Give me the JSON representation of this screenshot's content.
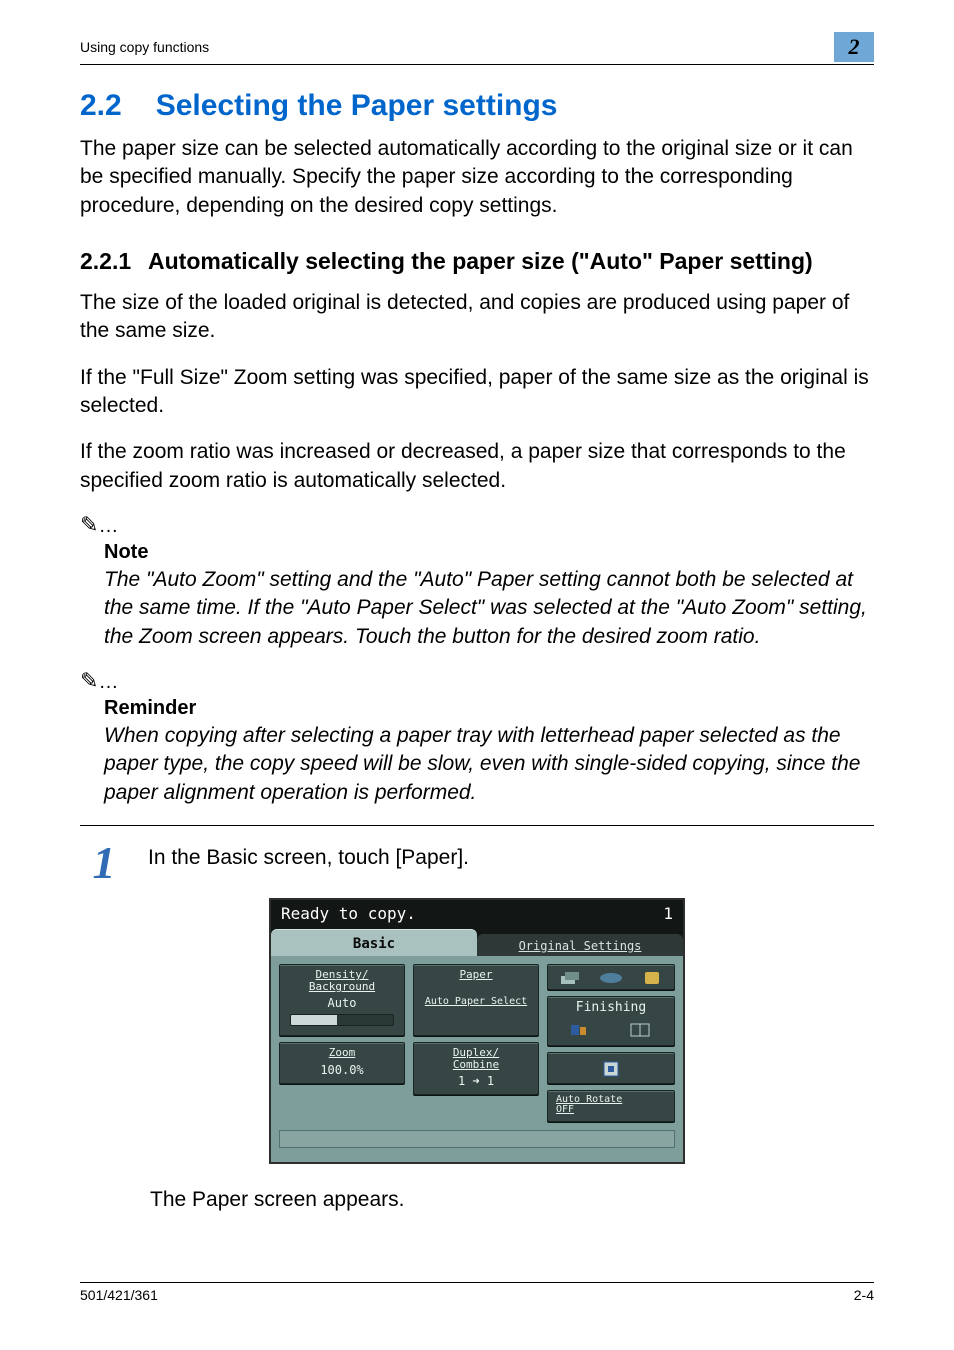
{
  "header": {
    "running_title": "Using copy functions",
    "chapter_number": "2"
  },
  "section": {
    "number": "2.2",
    "title": "Selecting the Paper settings",
    "intro": "The paper size can be selected automatically according to the original size or it can be specified manually. Specify the paper size according to the corresponding procedure, depending on the desired copy settings."
  },
  "subsection": {
    "number": "2.2.1",
    "title": "Automatically selecting the paper size (\"Auto\" Paper setting)",
    "p1": "The size of the loaded original is detected, and copies are produced using paper of the same size.",
    "p2": "If the \"Full Size\" Zoom setting was specified, paper of the same size as the original is selected.",
    "p3": "If the zoom ratio was increased or decreased, a paper size that corresponds to the specified zoom ratio is automatically selected."
  },
  "note": {
    "label": "Note",
    "body": "The \"Auto Zoom\" setting and the \"Auto\" Paper setting cannot both be selected at the same time. If the \"Auto Paper Select\" was selected at the \"Auto Zoom\" setting, the Zoom screen appears. Touch the button for the desired zoom ratio."
  },
  "reminder": {
    "label": "Reminder",
    "body": "When copying after selecting a paper tray with letterhead paper selected as the paper type, the copy speed will be slow, even with single-sided copying, since the paper alignment operation is performed."
  },
  "step": {
    "number": "1",
    "text": "In the Basic screen, touch [Paper].",
    "result": "The Paper screen appears."
  },
  "screen": {
    "status_text": "Ready to copy.",
    "count": "1",
    "tabs": {
      "basic": "Basic",
      "original": "Original\nSettings"
    },
    "density": {
      "title": "Density/\nBackground",
      "value": "Auto"
    },
    "zoom": {
      "title": "Zoom",
      "value": "100.0%"
    },
    "paper": {
      "title": "Paper",
      "sub": "Auto Paper\nSelect"
    },
    "duplex": {
      "title": "Duplex/\nCombine",
      "value": "1 ➜ 1"
    },
    "finishing": {
      "title": "Finishing"
    },
    "auto_rotate": "Auto Rotate\nOFF"
  },
  "footer": {
    "left": "501/421/361",
    "right": "2-4"
  }
}
